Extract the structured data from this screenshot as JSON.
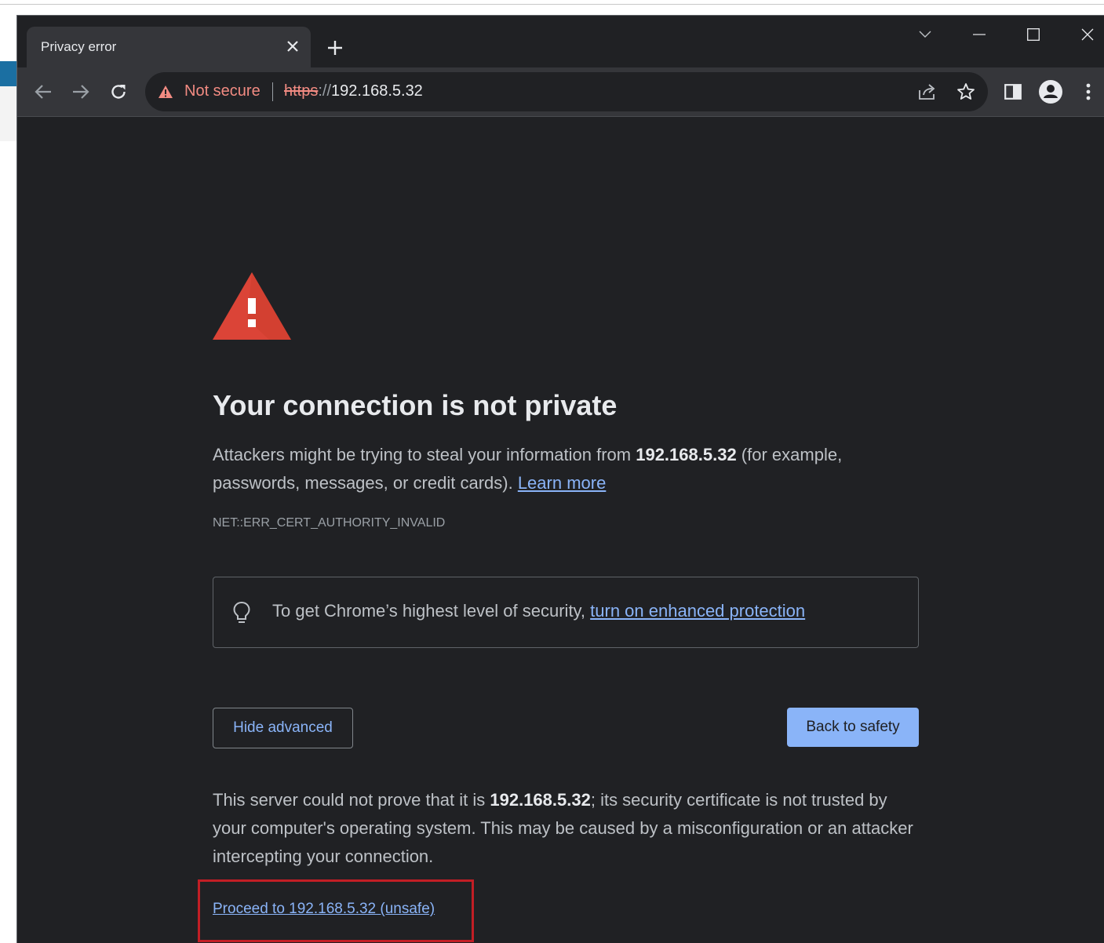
{
  "browser": {
    "tab": {
      "title": "Privacy error"
    },
    "omnibox": {
      "security_label": "Not secure",
      "url_scheme": "https",
      "url_separator": "://",
      "url_host": "192.168.5.32"
    },
    "icons": {
      "back": "arrow-left-icon",
      "forward": "arrow-right-icon",
      "reload": "reload-icon",
      "share": "share-icon",
      "bookmark": "star-icon",
      "sidepanel": "side-panel-icon",
      "profile": "profile-icon",
      "menu": "kebab-menu-icon"
    }
  },
  "page": {
    "heading": "Your connection is not private",
    "intro": {
      "before": "Attackers might be trying to steal your information from ",
      "host": "192.168.5.32",
      "after": " (for example, passwords, messages, or credit cards). ",
      "learn_more": "Learn more"
    },
    "error_code": "NET::ERR_CERT_AUTHORITY_INVALID",
    "enhanced": {
      "text": "To get Chrome’s highest level of security, ",
      "link": "turn on enhanced protection"
    },
    "buttons": {
      "hide_advanced": "Hide advanced",
      "back_to_safety": "Back to safety"
    },
    "details": {
      "before": "This server could not prove that it is ",
      "host": "192.168.5.32",
      "after": "; its security certificate is not trusted by your computer's operating system. This may be caused by a misconfiguration or an attacker intercepting your connection."
    },
    "proceed_link": "Proceed to 192.168.5.32 (unsafe)"
  },
  "colors": {
    "background": "#202124",
    "toolbar": "#35363a",
    "warning_red": "#f28b82",
    "link_blue": "#8ab4f8",
    "highlight_box": "#c21e25"
  }
}
